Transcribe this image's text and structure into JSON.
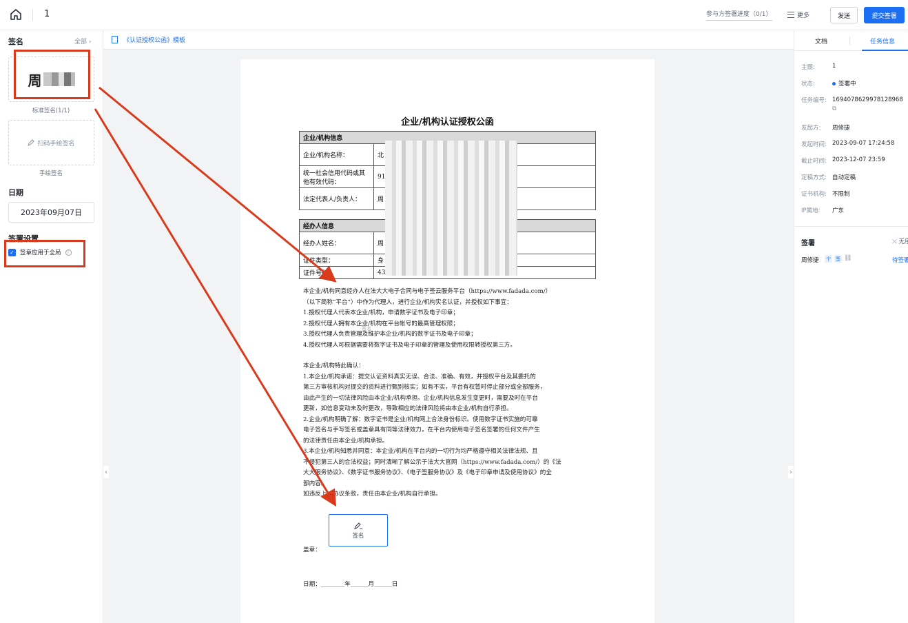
{
  "header": {
    "doc_title": "1",
    "progress_label": "参与方签署进度（0/1）",
    "more_label": "更多",
    "send_label": "发送",
    "submit_label": "提交签署"
  },
  "left_panel": {
    "signature_title": "签名",
    "all_label": "全部",
    "signature_name": "周",
    "standard_caption": "标准签名(1/1)",
    "handwrite_label": "扫码手绘签名",
    "handwrite_caption": "手绘签名",
    "date_title": "日期",
    "date_value": "2023年09月07日",
    "settings_title": "签署设置",
    "apply_global_label": "签章应用于全局",
    "apply_global_checked": true
  },
  "breadcrumb": {
    "template_label": "《认证授权公函》模板"
  },
  "document": {
    "title": "企业/机构认证授权公函",
    "org_section": "企业/机构信息",
    "org_rows": [
      {
        "label": "企业/机构名称：",
        "value": "北"
      },
      {
        "label": "统一社会信用代码或其他有效代码：",
        "value": "91"
      },
      {
        "label": "法定代表人/负责人：",
        "value": "周"
      }
    ],
    "agent_section": "经办人信息",
    "agent_rows": [
      {
        "label": "经办人姓名：",
        "value": "周"
      },
      {
        "label": "证件类型：",
        "value": "身"
      },
      {
        "label": "证件号码：",
        "value": "43"
      }
    ],
    "para1": [
      "本企业/机构同意经办人在法大大电子合同与电子签云服务平台（https://www.fadada.com/）",
      "（以下简称“平台”）中作为代理人，进行企业/机构实名认证，并授权如下事宜：",
      "1.授权代理人代表本企业/机构，申请数字证书及电子印章；",
      "2.授权代理人拥有本企业/机构在平台帐号的最高管理权限；",
      "3.授权代理人负责管理及维护本企业/机构的数字证书及电子印章；",
      "4.授权代理人可根据需要将数字证书及电子印章的管理及使用权限转授权第三方。"
    ],
    "para2": [
      "本企业/机构特此确认：",
      "1.本企业/机构承诺：提交认证资料真实无误、合法、准确、有效，并授权平台及其委托的",
      "第三方审核机构对提交的资料进行甄别核实；如有不实，平台有权暂时停止部分或全部服务，",
      "由此产生的一切法律风险由本企业/机构承担。企业/机构信息发生变更时，需要及时在平台",
      "更新，如信息变动未及时更改，导致相应的法律风险将由本企业/机构自行承担。",
      "2.企业/机构明确了解：数字证书是企业/机构网上合法身份标识。使用数字证书实施的可靠",
      "电子签名与手写签名或盖章具有同等法律效力，在平台内使用电子签名签署的任何文件产生",
      "的法律责任由本企业/机构承担。",
      "3.本企业/机构知悉并同意：本企业/机构在平台内的一切行为均严格遵守相关法律法规、且",
      "不侵犯第三人的合法权益；同时清晰了解公示于法大大官网（https://www.fadada.com/）的《法",
      "大大服务协议》、《数字证书服务协议》、《电子签服务协议》及《电子印章申请及使用协议》的全",
      "部内容。",
      "如违反上述协议条款，责任由本企业/机构自行承担。"
    ],
    "sign_field_label": "签名",
    "ghost_label": "签名",
    "stamp_label": "盖章：",
    "date_line": "日期：________年______月______日"
  },
  "right_panel": {
    "tab_doc": "文档",
    "tab_task": "任务信息",
    "fields": [
      {
        "key": "主题:",
        "value": "1"
      },
      {
        "key": "状态:",
        "value": "签署中"
      },
      {
        "key": "任务编号:",
        "value": "169407862997812896"
      },
      {
        "key": "发起方:",
        "value": "周修捷"
      },
      {
        "key": "发起时间:",
        "value": "2023-09-07 17:24:58"
      },
      {
        "key": "截止时间:",
        "value": "2023-12-07 23:59"
      },
      {
        "key": "定稿方式:",
        "value": "自动定稿"
      },
      {
        "key": "证书机构:",
        "value": "不限制"
      },
      {
        "key": "IP属地:",
        "value": "广东"
      }
    ],
    "task_no_tail": "8",
    "sign_section_title": "签署",
    "sign_section_extra": "无序",
    "signer_name": "周修捷",
    "signer_status": "待签署"
  },
  "colors": {
    "accent": "#1c6ef2",
    "annotation_red": "#d93a1c"
  },
  "icons": [
    "home-icon",
    "menu-icon",
    "file-icon",
    "pen-icon",
    "copy-icon",
    "info-icon",
    "check-icon",
    "collapse-left-icon",
    "collapse-right-icon",
    "link-icon"
  ]
}
